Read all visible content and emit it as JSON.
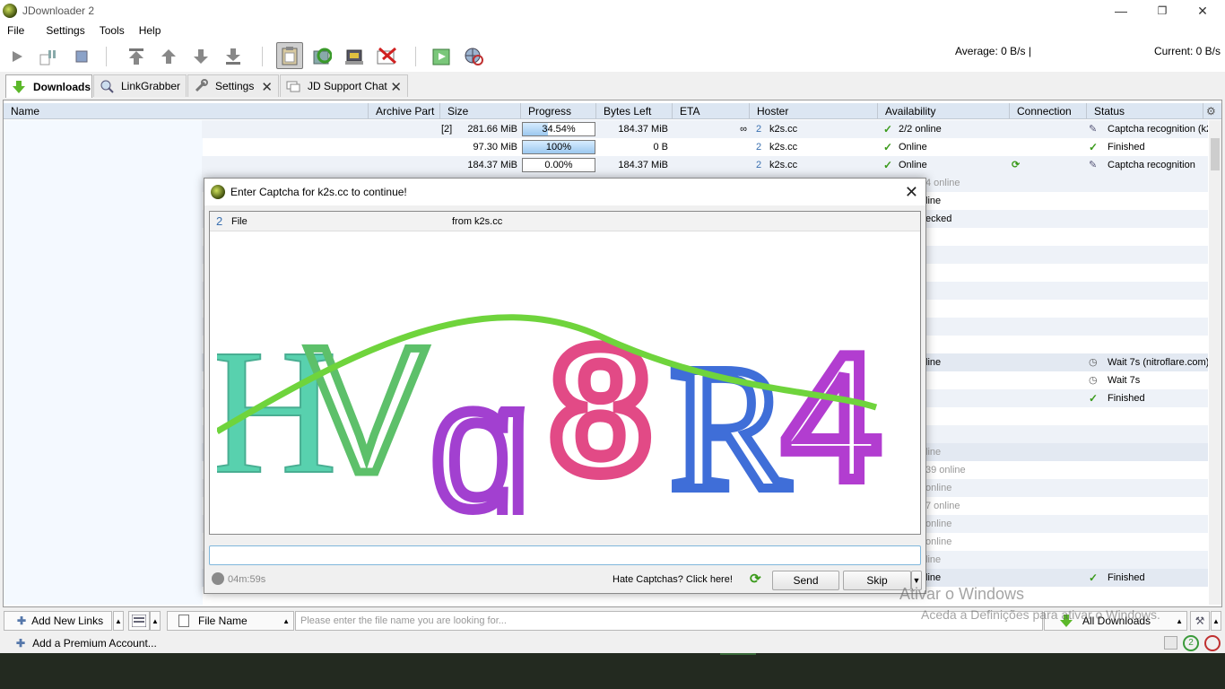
{
  "window": {
    "title": "JDownloader 2",
    "minimize": "—",
    "restore": "❐",
    "close": "✕"
  },
  "menu": [
    "File",
    "Settings",
    "Tools",
    "Help"
  ],
  "toolbar": {
    "average_speed": "Average: 0 B/s |",
    "current_speed": "Current: 0 B/s"
  },
  "tabs": [
    {
      "label": "Downloads"
    },
    {
      "label": "LinkGrabber"
    },
    {
      "label": "Settings"
    },
    {
      "label": "JD Support Chat"
    }
  ],
  "table": {
    "columns": [
      "Name",
      "Archive Part",
      "Size",
      "Progress",
      "Bytes Left",
      "ETA",
      "Hoster",
      "Availability",
      "Connection",
      "Status"
    ],
    "rows": [
      {
        "archive": "[2]",
        "size": "281.66 MiB",
        "progress": "34.54%",
        "progress_value": 0.3454,
        "bytes_left": "184.37 MiB",
        "eta": "∞",
        "hoster": "k2s.cc",
        "availability": "2/2 online",
        "status": "Captcha recognition (k2"
      },
      {
        "archive": "",
        "size": "97.30 MiB",
        "progress": "100%",
        "progress_value": 1.0,
        "bytes_left": "0 B",
        "eta": "",
        "hoster": "k2s.cc",
        "availability": "Online",
        "status": "Finished"
      },
      {
        "archive": "",
        "size": "184.37 MiB",
        "progress": "0.00%",
        "progress_value": 0.0,
        "bytes_left": "184.37 MiB",
        "eta": "",
        "hoster": "k2s.cc",
        "availability": "Online",
        "status": "Captcha recognition"
      }
    ],
    "partial_rows": [
      {
        "availability": "4 online",
        "status": ""
      },
      {
        "availability": "line",
        "status": ""
      },
      {
        "availability": "ecked",
        "status": ""
      },
      {
        "availability": "line",
        "status": "Wait 7s (nitroflare.com)"
      },
      {
        "availability": "",
        "status": "Wait 7s"
      },
      {
        "availability": "",
        "status": "Finished"
      },
      {
        "availability": "line",
        "status": ""
      },
      {
        "availability": "39 online",
        "status": ""
      },
      {
        "availability": "online",
        "status": ""
      },
      {
        "availability": "7 online",
        "status": ""
      },
      {
        "availability": "online",
        "status": ""
      },
      {
        "availability": "online",
        "status": ""
      },
      {
        "availability": "line",
        "status": ""
      },
      {
        "availability": "line",
        "status": "Finished"
      }
    ]
  },
  "dialog": {
    "title": "Enter Captcha for k2s.cc to continue!",
    "file_label": "File",
    "from_label": "from k2s.cc",
    "captcha_text": "HVq8R4",
    "timer": "04m:59s",
    "hate_captchas": "Hate Captchas? Click here!",
    "send": "Send",
    "skip": "Skip"
  },
  "bottombar": {
    "add_links": "Add New Links",
    "search_field": "File Name",
    "search_placeholder": "Please enter the file name you are looking for...",
    "all_downloads": "All Downloads"
  },
  "statusbar": {
    "premium": "Add a Premium Account..."
  },
  "watermark": {
    "line1": "Ativar o Windows",
    "line2": "Aceda a Definições para ativar o Windows."
  }
}
